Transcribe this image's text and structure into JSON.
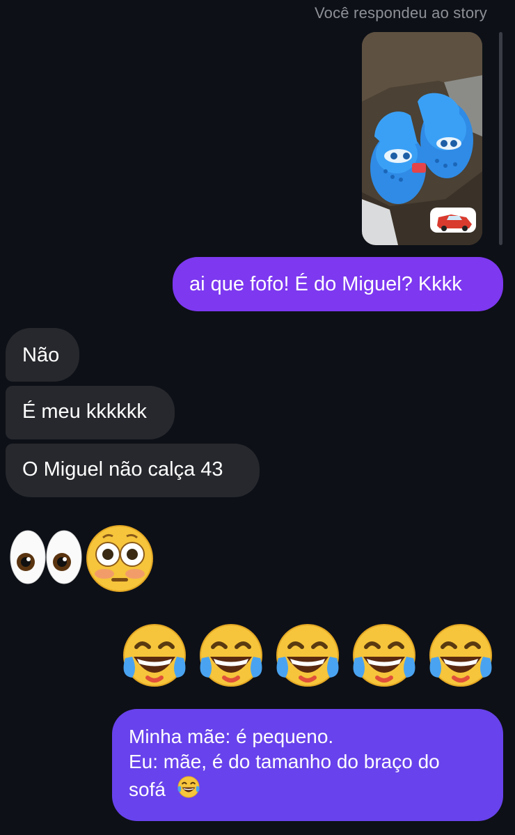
{
  "thread": {
    "story_label": "Você respondeu ao story"
  },
  "messages": {
    "reply_to_story": "ai que fofo! É do Miguel? Kkkk",
    "incoming": [
      "Não",
      "É meu kkkkkk",
      "O Miguel não calça 43"
    ],
    "eyes_emoji_names": [
      "eyes-emoji",
      "flushed-face-emoji"
    ],
    "laugh_emoji_count": 5,
    "last_message_lines": [
      "Minha mãe: é pequeno.",
      "Eu: mãe, é do tamanho do braço do",
      "sofá"
    ]
  },
  "colors": {
    "background": "#0d1017",
    "outgoing_bubble": "#7d38f0",
    "outgoing_bubble_2": "#6842ec",
    "incoming_bubble": "#26282d",
    "label": "#8e9096"
  }
}
